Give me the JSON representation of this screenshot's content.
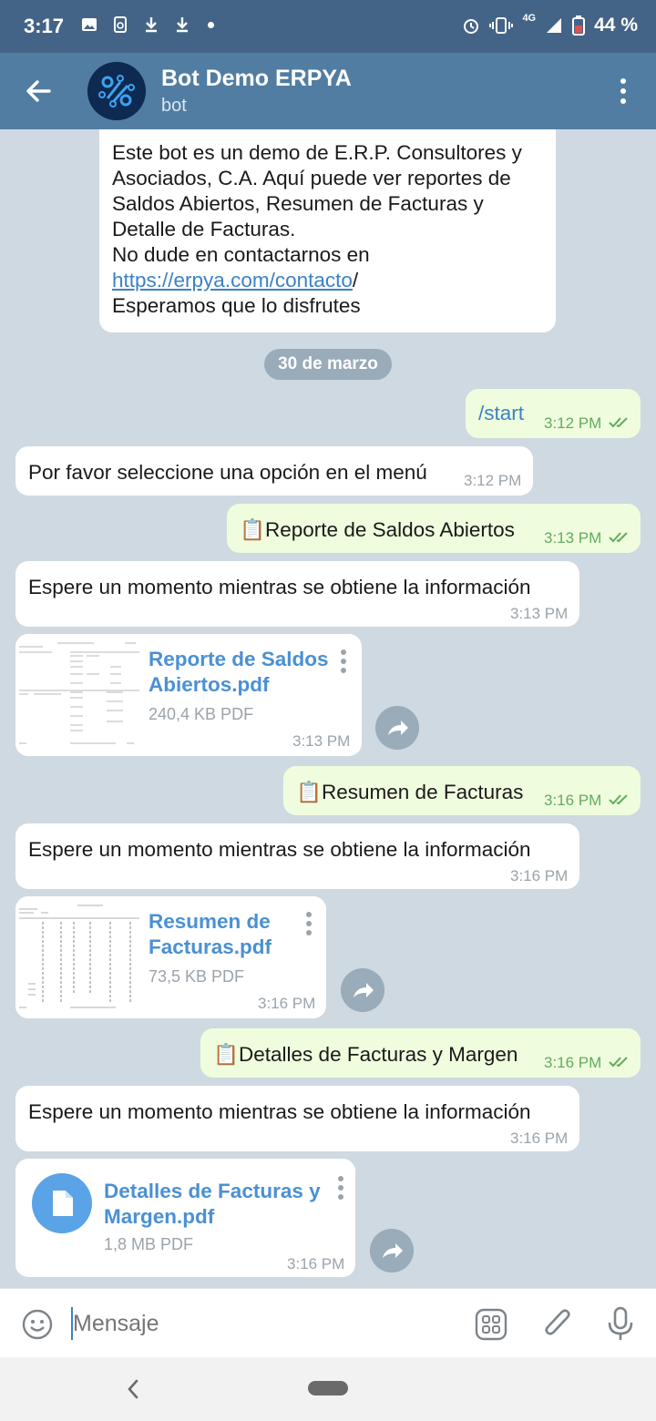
{
  "status_bar": {
    "time": "3:17",
    "network": "4G",
    "battery": "44 %",
    "icons": [
      "image-icon",
      "sync-icon",
      "download-icon",
      "download-icon",
      "dot-icon",
      "alarm-icon",
      "vibrate-icon",
      "signal-icon",
      "battery-icon"
    ]
  },
  "header": {
    "title": "Bot Demo ERPYA",
    "subtitle": "bot",
    "accent": "#517da2"
  },
  "intro_message": {
    "lines": [
      "Este bot es un demo de E.R.P. Consultores y",
      "Asociados, C.A. Aquí puede ver reportes de",
      "Saldos Abiertos, Resumen de Facturas y",
      "Detalle de Facturas.",
      "No dude en contactarnos en"
    ],
    "link": "https://erpya.com/contacto",
    "link_suffix": "/",
    "last_line": "Esperamos que lo disfrutes"
  },
  "date_divider": "30 de marzo",
  "messages": [
    {
      "dir": "out",
      "text": "/start",
      "time": "3:12 PM",
      "read": true
    },
    {
      "dir": "in",
      "text": "Por favor seleccione una opción en el menú",
      "time": "3:12 PM"
    },
    {
      "dir": "out",
      "text": "📋Reporte de Saldos Abiertos",
      "time": "3:13 PM",
      "read": true
    },
    {
      "dir": "in",
      "text": "Espere un momento mientras se obtiene la información",
      "time": "3:13 PM"
    },
    {
      "dir": "out",
      "text": "📋Resumen de Facturas",
      "time": "3:16 PM",
      "read": true
    },
    {
      "dir": "in",
      "text": "Espere un momento mientras se obtiene la información",
      "time": "3:16 PM"
    },
    {
      "dir": "out",
      "text": "📋Detalles de Facturas y Margen",
      "time": "3:16 PM",
      "read": true
    },
    {
      "dir": "in",
      "text": "Espere un momento mientras se obtiene la información",
      "time": "3:16 PM"
    }
  ],
  "files": [
    {
      "name_line1": "Reporte de Saldos",
      "name_line2": "Abiertos.pdf",
      "size": "240,4 KB PDF",
      "time": "3:13 PM"
    },
    {
      "name_line1": "Resumen de",
      "name_line2": "Facturas.pdf",
      "size": "73,5 KB PDF",
      "time": "3:16 PM"
    },
    {
      "name_line1": "Detalles de Facturas y",
      "name_line2": "Margen.pdf",
      "size": "1,8 MB PDF",
      "time": "3:16 PM"
    }
  ],
  "composer": {
    "placeholder": "Mensaje"
  }
}
